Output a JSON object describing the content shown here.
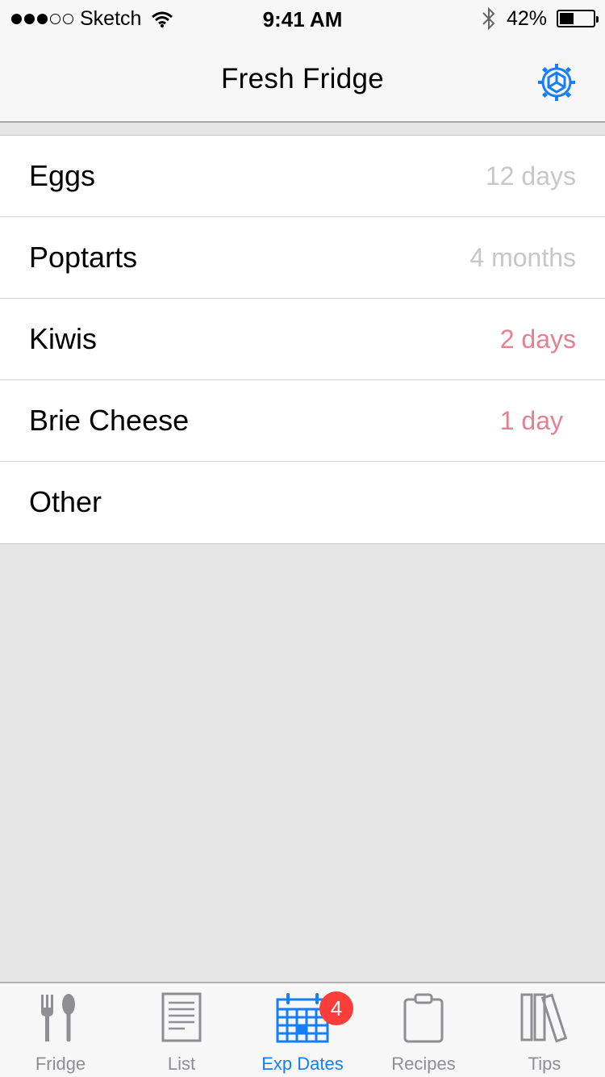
{
  "status_bar": {
    "carrier": "Sketch",
    "time": "9:41 AM",
    "battery_percent": "42%",
    "battery_level": 0.42,
    "signal_bars": 3,
    "signal_total": 5
  },
  "nav": {
    "title": "Fresh Fridge",
    "settings_icon": "gear-icon"
  },
  "items": [
    {
      "name": "Eggs",
      "expires": "12 days",
      "state": "ok"
    },
    {
      "name": "Poptarts",
      "expires": "4 months",
      "state": "ok"
    },
    {
      "name": "Kiwis",
      "expires": "2 days",
      "state": "warn"
    },
    {
      "name": "Brie Cheese",
      "expires": "1 day",
      "state": "warn"
    },
    {
      "name": "Other",
      "expires": "",
      "state": "ok"
    }
  ],
  "tabs": [
    {
      "label": "Fridge",
      "icon": "fork-spoon-icon"
    },
    {
      "label": "List",
      "icon": "list-icon"
    },
    {
      "label": "Exp Dates",
      "icon": "calendar-icon",
      "badge": "4",
      "active": true
    },
    {
      "label": "Recipes",
      "icon": "clipboard-icon"
    },
    {
      "label": "Tips",
      "icon": "books-icon"
    }
  ],
  "colors": {
    "accent": "#157efb",
    "expiring": "#e3818e",
    "muted": "#c7c7c7",
    "badge": "#fc3d39"
  }
}
